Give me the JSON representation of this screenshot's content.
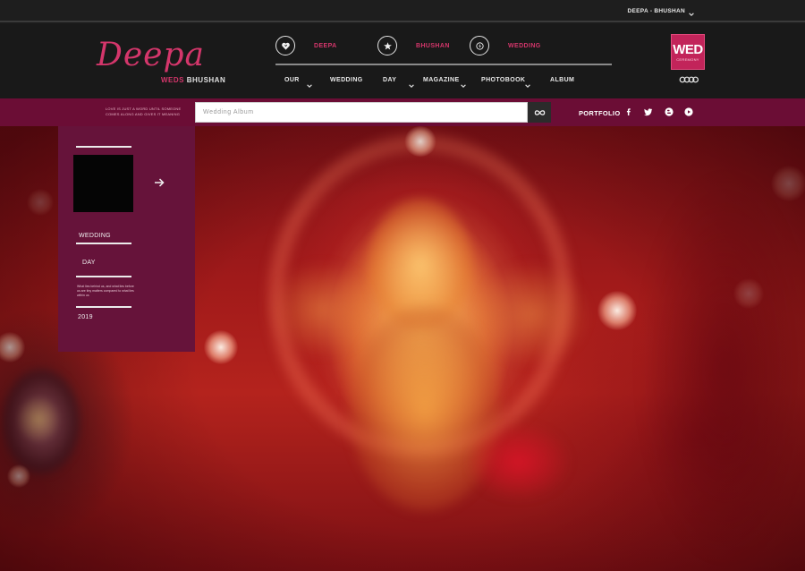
{
  "topbar": {
    "user_menu": "DEEPA - BHUSHAN"
  },
  "header": {
    "logo": {
      "script": "Deepa",
      "sub_prefix": "WEDS",
      "sub_name": "BHUSHAN"
    },
    "tabs": [
      {
        "label": "DEEPA",
        "icon": "heart-icon"
      },
      {
        "label": "BHUSHAN",
        "icon": "star-icon"
      },
      {
        "label": "WEDDING",
        "icon": "bolt-icon"
      }
    ],
    "nav": [
      {
        "label": "OUR"
      },
      {
        "label": "WEDDING"
      },
      {
        "label": "DAY"
      },
      {
        "label": "MAGAZINE"
      },
      {
        "label": "PHOTOBOOK"
      },
      {
        "label": "ALBUM"
      }
    ],
    "badge": {
      "big": "WED",
      "small": "CEREMONY"
    }
  },
  "strip": {
    "tagline": "LOVE IS JUST A WORD UNTIL SOMEONE COMES ALONG AND GIVES IT MEANING",
    "search_placeholder": "Wedding Album",
    "portfolio": "PORTFOLIO",
    "social": [
      "facebook-icon",
      "twitter-icon",
      "blogger-icon",
      "youtube-icon"
    ]
  },
  "panel": {
    "title_1": "WEDDING",
    "title_2": "DAY",
    "description": "What lies behind us, and what lies before us are tiny matters compared to what lies within us",
    "year": "2019"
  },
  "colors": {
    "accent": "#d4366b",
    "strip": "#6b0d35",
    "panel": "#66133a",
    "header": "#191919"
  }
}
